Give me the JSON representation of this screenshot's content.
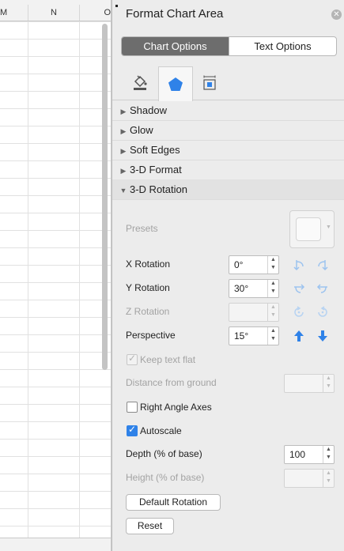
{
  "sheet": {
    "columns": [
      "M",
      "N",
      "O"
    ]
  },
  "panel": {
    "title": "Format Chart Area",
    "close_icon": "close-icon",
    "segments": [
      "Chart Options",
      "Text Options"
    ],
    "active_segment": "Chart Options",
    "icon_tabs": [
      {
        "icon": "fill-line-icon",
        "active": false
      },
      {
        "icon": "effects-pentagon-icon",
        "active": true
      },
      {
        "icon": "size-properties-icon",
        "active": false
      }
    ],
    "sections": [
      {
        "label": "Shadow",
        "expanded": false
      },
      {
        "label": "Glow",
        "expanded": false
      },
      {
        "label": "Soft Edges",
        "expanded": false
      },
      {
        "label": "3-D Format",
        "expanded": false
      },
      {
        "label": "3-D Rotation",
        "expanded": true
      }
    ],
    "rotation": {
      "presets_label": "Presets",
      "x_label": "X Rotation",
      "x_value": "0°",
      "y_label": "Y Rotation",
      "y_value": "30°",
      "z_label": "Z Rotation",
      "z_value": "",
      "perspective_label": "Perspective",
      "perspective_value": "15°",
      "keep_text_flat_label": "Keep text flat",
      "keep_text_flat_checked": true,
      "distance_label": "Distance from ground",
      "distance_value": "",
      "right_angle_label": "Right Angle Axes",
      "right_angle_checked": false,
      "autoscale_label": "Autoscale",
      "autoscale_checked": true,
      "depth_label": "Depth (% of base)",
      "depth_value": "100",
      "height_label": "Height (% of base)",
      "height_value": "",
      "default_rotation_label": "Default Rotation",
      "reset_label": "Reset"
    },
    "accent_color": "#2f82e8"
  }
}
